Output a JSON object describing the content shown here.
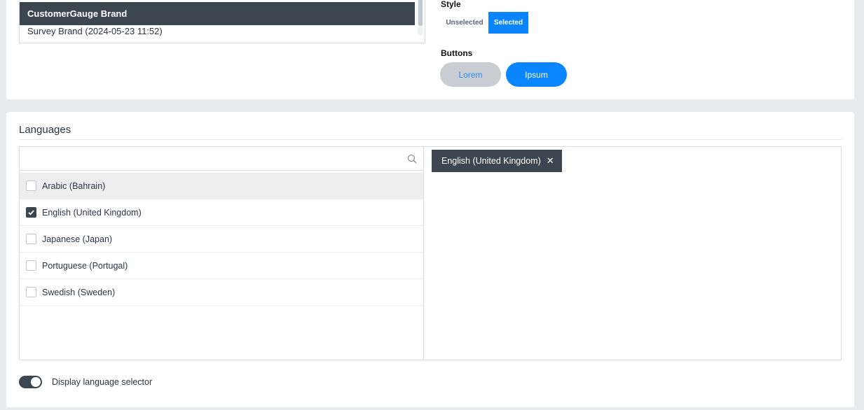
{
  "brand_list": {
    "items": [
      {
        "label": "CustomerGauge Brand",
        "selected": true
      },
      {
        "label": "Survey Brand (2024-05-23 11:52)",
        "selected": false
      }
    ]
  },
  "style_section": {
    "label": "Style",
    "unselected_label": "Unselected",
    "selected_label": "Selected"
  },
  "buttons_section": {
    "label": "Buttons",
    "lorem_label": "Lorem",
    "ipsum_label": "Ipsum"
  },
  "languages": {
    "title": "Languages",
    "search_placeholder": "",
    "options": [
      {
        "label": "Arabic (Bahrain)",
        "checked": false
      },
      {
        "label": "English (United Kingdom)",
        "checked": true
      },
      {
        "label": "Japanese (Japan)",
        "checked": false
      },
      {
        "label": "Portuguese (Portugal)",
        "checked": false
      },
      {
        "label": "Swedish (Sweden)",
        "checked": false
      }
    ],
    "selected_chips": [
      {
        "label": "English (United Kingdom)"
      }
    ],
    "toggle_label": "Display language selector",
    "toggle_on": true
  },
  "colors": {
    "accent": "#0a84ff",
    "dark": "#3c4650",
    "background": "#e9eaed"
  }
}
